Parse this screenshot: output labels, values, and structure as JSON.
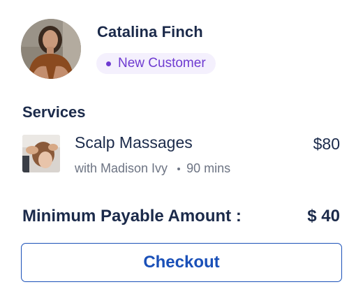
{
  "customer": {
    "name": "Catalina Finch",
    "badge_label": "New Customer"
  },
  "services": {
    "title": "Services",
    "items": [
      {
        "name": "Scalp Massages",
        "price": "$80",
        "provider": "with Madison Ivy",
        "duration": "90 mins"
      }
    ]
  },
  "payment": {
    "min_label": "Minimum Payable Amount :",
    "min_value": "$ 40"
  },
  "actions": {
    "checkout_label": "Checkout"
  },
  "colors": {
    "text_primary": "#1b2a4a",
    "text_secondary": "#6d7483",
    "badge_text": "#6f3bd1",
    "badge_bg": "#f4f0fd",
    "accent": "#1a50b8"
  }
}
